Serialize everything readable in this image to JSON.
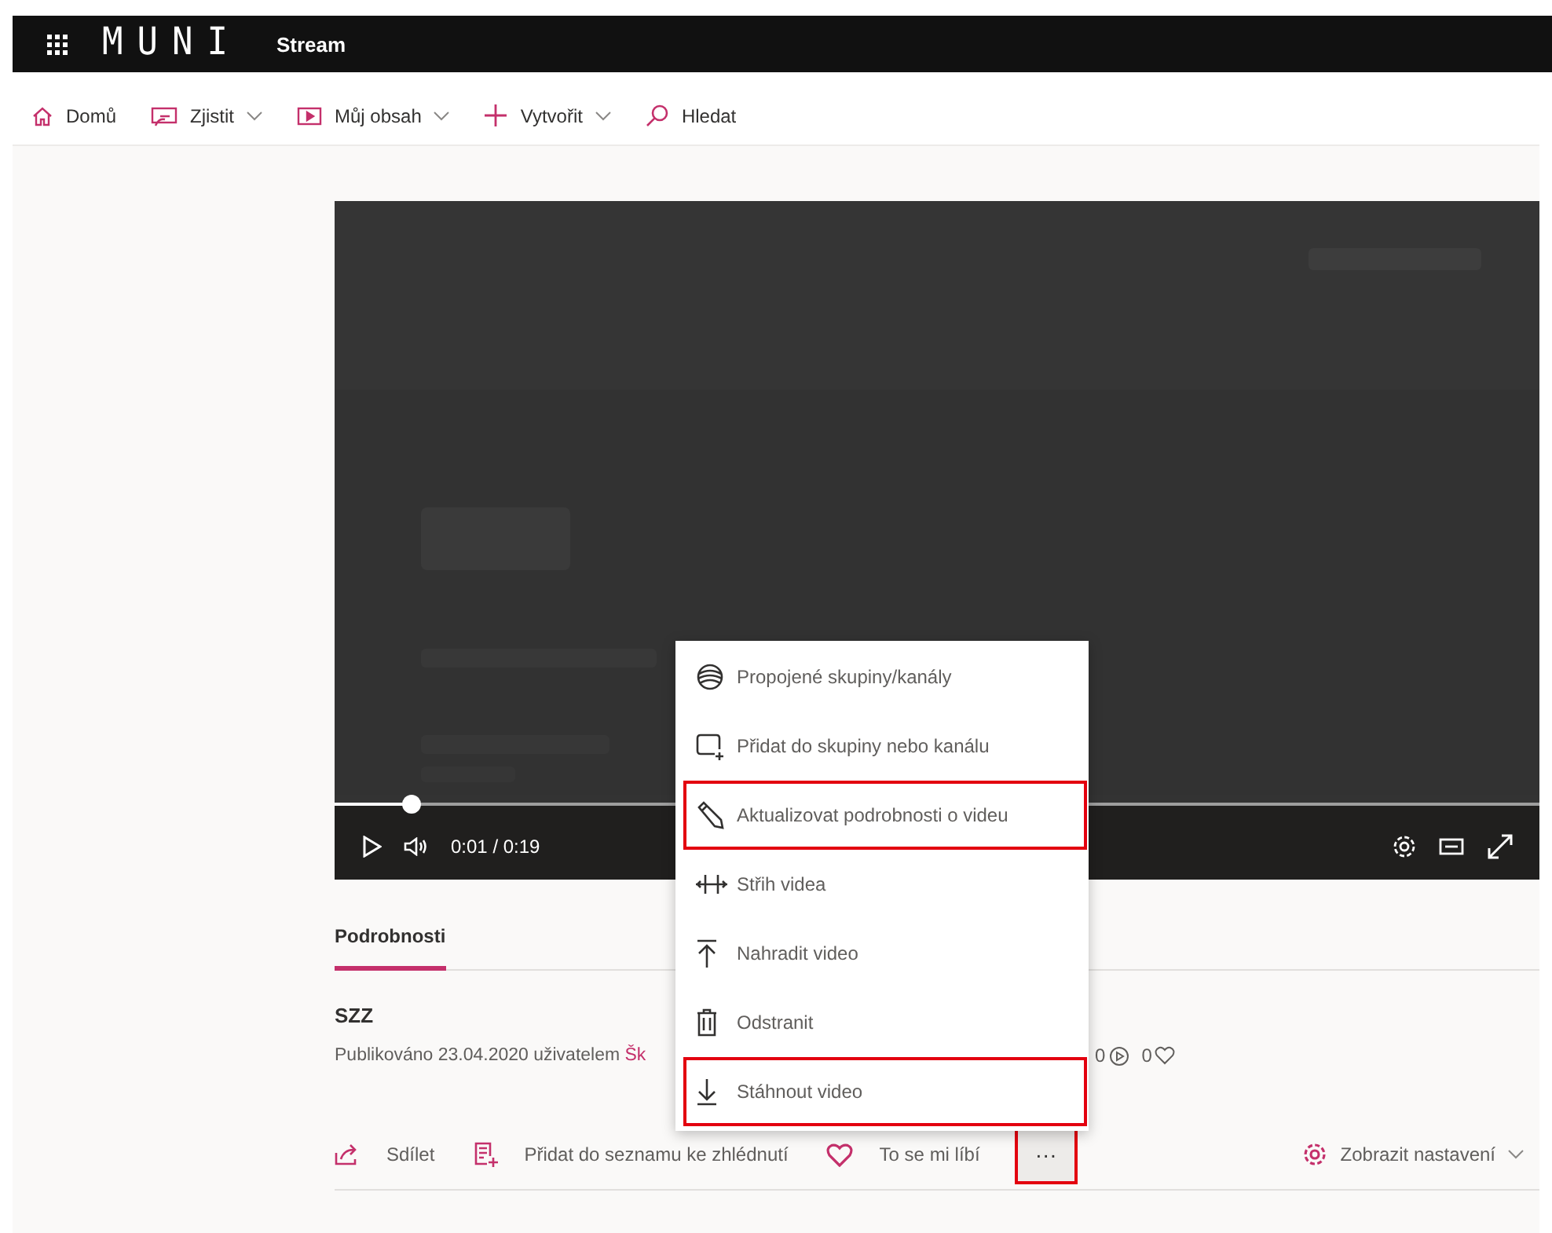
{
  "header": {
    "logo": "MUNI",
    "app_name": "Stream"
  },
  "nav": [
    {
      "label": "Domů",
      "dropdown": false
    },
    {
      "label": "Zjistit",
      "dropdown": true
    },
    {
      "label": "Můj obsah",
      "dropdown": true
    },
    {
      "label": "Vytvořit",
      "dropdown": true
    },
    {
      "label": "Hledat",
      "dropdown": false
    }
  ],
  "player": {
    "progress": {
      "level": 0.064
    },
    "time": "0:01 / 0:19"
  },
  "tabs": [
    {
      "label": "Podrobnosti",
      "selected": true
    }
  ],
  "video": {
    "title": "SZZ",
    "published": "Publikováno 23.04.2020 uživatelem ",
    "author_link": "Šk",
    "views": "0",
    "likes": "0"
  },
  "actions": [
    {
      "label": "Sdílet"
    },
    {
      "label": "Přidat do seznamu ke zhlédnutí"
    },
    {
      "label": "To se mi líbí"
    }
  ],
  "more_button": {
    "label": "···",
    "highlighted": true
  },
  "settings_button": {
    "label": "Zobrazit nastavení"
  },
  "menu": {
    "items": [
      {
        "label": "Propojené skupiny/kanály",
        "highlighted": false
      },
      {
        "label": "Přidat do skupiny nebo kanálu",
        "highlighted": false
      },
      {
        "label": "Aktualizovat podrobnosti o videu",
        "highlighted": true
      },
      {
        "label": "Střih videa",
        "highlighted": false
      },
      {
        "label": "Nahradit video",
        "highlighted": false
      },
      {
        "label": "Odstranit",
        "highlighted": false
      },
      {
        "label": "Stáhnout video",
        "highlighted": true
      }
    ]
  }
}
